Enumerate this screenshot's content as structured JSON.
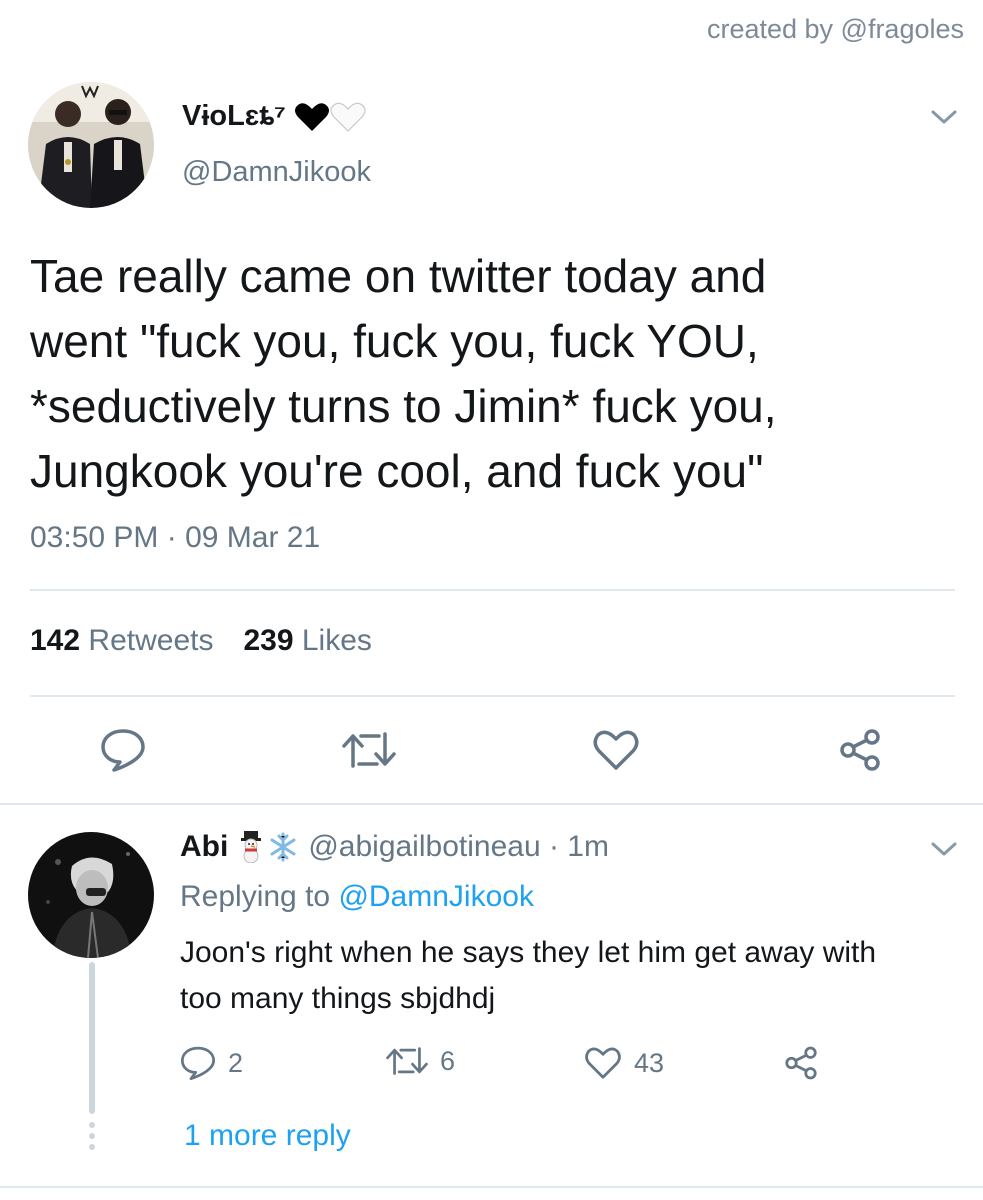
{
  "credit": "created by @fragoles",
  "tweet": {
    "display_name": "VɨoLɛȶ⁷",
    "name_emoji": [
      "black-heart",
      "white-heart"
    ],
    "handle": "@DamnJikook",
    "text": "Tae really came on twitter today and\nwent \"fuck you, fuck you, fuck YOU,\n*seductively turns to Jimin* fuck you,\nJungkook you're cool, and fuck you\"",
    "timestamp": "03:50 PM · 09 Mar 21",
    "retweets_count": "142",
    "retweets_label": "Retweets",
    "likes_count": "239",
    "likes_label": "Likes"
  },
  "reply": {
    "display_name": "Abi",
    "name_emoji": [
      "snowman",
      "snowflake"
    ],
    "handle_time": "@abigailbotineau · 1m",
    "replying_prefix": "Replying to",
    "replying_to": "@DamnJikook",
    "text": "Joon's right when he says they let him get away with too many things sbjdhdj",
    "reply_count": "2",
    "retweet_count": "6",
    "like_count": "43"
  },
  "more_replies": "1 more reply",
  "colors": {
    "text": "#14171a",
    "secondary": "#657786",
    "link": "#1da1f2",
    "divider": "#e1e8ed"
  }
}
